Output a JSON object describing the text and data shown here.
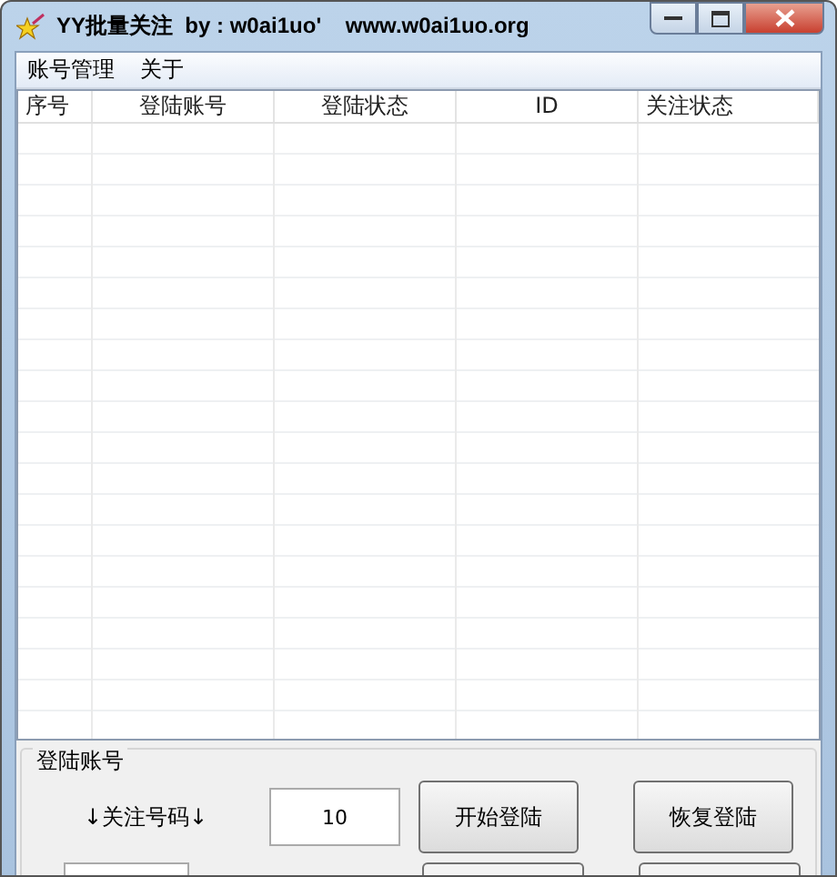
{
  "window": {
    "title": "YY批量关注  by : w0ai1uo'    www.w0ai1uo.org"
  },
  "menu": [
    "账号管理",
    "关于"
  ],
  "table": {
    "columns": [
      "序号",
      "登陆账号",
      "登陆状态",
      "ID",
      "关注状态"
    ]
  },
  "group": {
    "title": "登陆账号",
    "label": "↓关注号码↓",
    "count_field": {
      "value": "10"
    },
    "buttons": [
      "开始登陆",
      "恢复登陆"
    ]
  }
}
